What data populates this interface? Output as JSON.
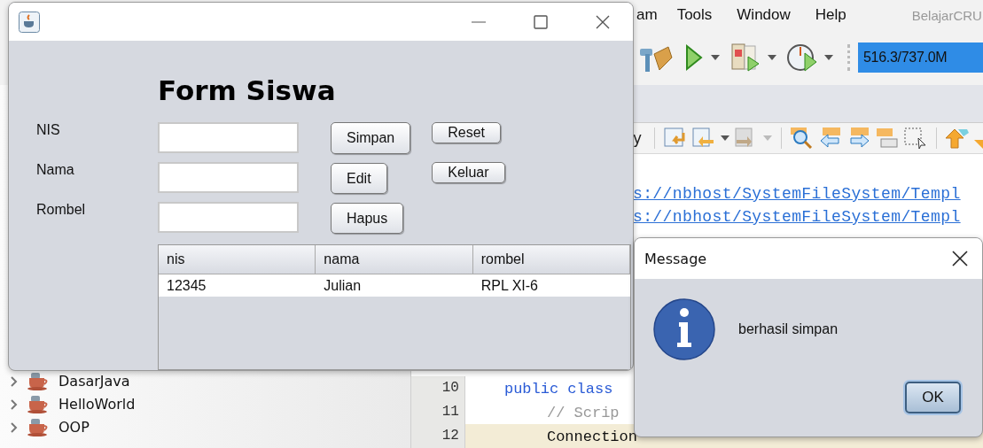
{
  "ide": {
    "menu": [
      "am",
      "Tools",
      "Window",
      "Help"
    ],
    "title": "BelajarCRU",
    "memory": "516.3/737.0M",
    "editor_toolbar_label": "y",
    "links": [
      "s://nbhost/SystemFileSystem/Templ",
      "s://nbhost/SystemFileSystem/Templ"
    ],
    "code": [
      {
        "number": "10",
        "text": "public class",
        "kind": "keyword",
        "highlighted": false
      },
      {
        "number": "11",
        "text": "// Scrip",
        "kind": "comment",
        "highlighted": false
      },
      {
        "number": "12",
        "text": "Connection",
        "kind": "plain",
        "highlighted": true
      }
    ],
    "projects": [
      "DasarJava",
      "HelloWorld",
      "OOP"
    ]
  },
  "form_window": {
    "heading": "Form Siswa",
    "fields": [
      {
        "label": "NIS"
      },
      {
        "label": "Nama"
      },
      {
        "label": "Rombel"
      }
    ],
    "buttons": [
      "Simpan",
      "Edit",
      "Hapus"
    ],
    "side_buttons": [
      "Reset",
      "Keluar"
    ],
    "table": {
      "columns": [
        "nis",
        "nama",
        "rombel"
      ],
      "rows": [
        [
          "12345",
          "Julian",
          "RPL XI-6"
        ]
      ]
    }
  },
  "dialog": {
    "title": "Message",
    "message": "berhasil simpan",
    "button": "OK"
  }
}
